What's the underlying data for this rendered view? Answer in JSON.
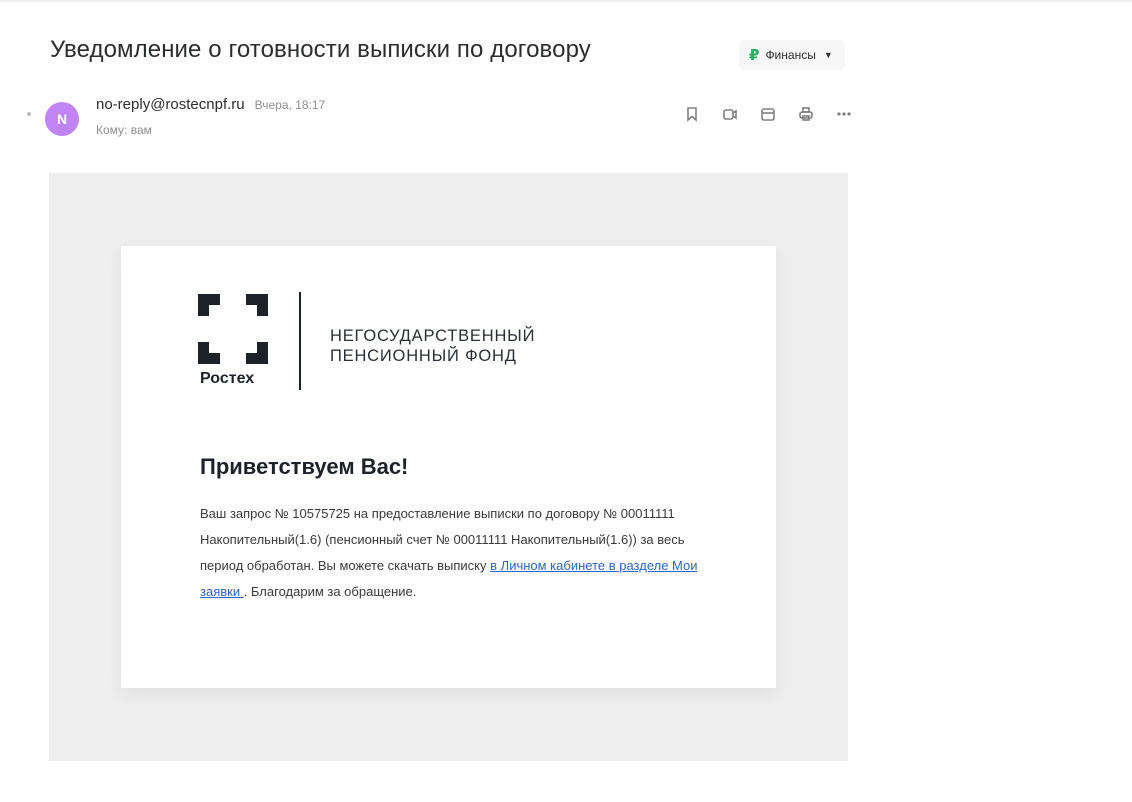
{
  "message": {
    "subject": "Уведомление о готовности выписки по договору",
    "folder": {
      "label": "Финансы",
      "icon": "ruble-icon",
      "icon_glyph": "₽",
      "accent": "#27ae60"
    },
    "sender": {
      "avatar_letter": "N",
      "avatar_color": "#c084f5",
      "email": "no-reply@rostecnpf.ru",
      "time": "Вчера, 18:17",
      "recipient": "Кому: вам"
    },
    "toolbar": [
      {
        "name": "bookmark-icon"
      },
      {
        "name": "reply-icon"
      },
      {
        "name": "calendar-icon"
      },
      {
        "name": "print-icon"
      },
      {
        "name": "more-icon"
      }
    ]
  },
  "letter": {
    "brand": {
      "logo_word": "Ростех",
      "fund_line_1": "НЕГОСУДАРСТВЕННЫЙ",
      "fund_line_2": "ПЕНСИОННЫЙ ФОНД"
    },
    "greeting": "Приветствуем Вас!",
    "body": {
      "text_before_link": "Ваш запрос № 10575725 на предоставление выписки по договору № 00011111   Накопительный(1.6) (пенсионный счет № 00011111 Накопительный(1.6)) за весь период обработан. Вы можете скачать выписку ",
      "link_text": "в Личном кабинете в разделе Мои заявки ",
      "text_after_link": ". Благодарим за обращение."
    },
    "link_color": "#2b65c7"
  }
}
